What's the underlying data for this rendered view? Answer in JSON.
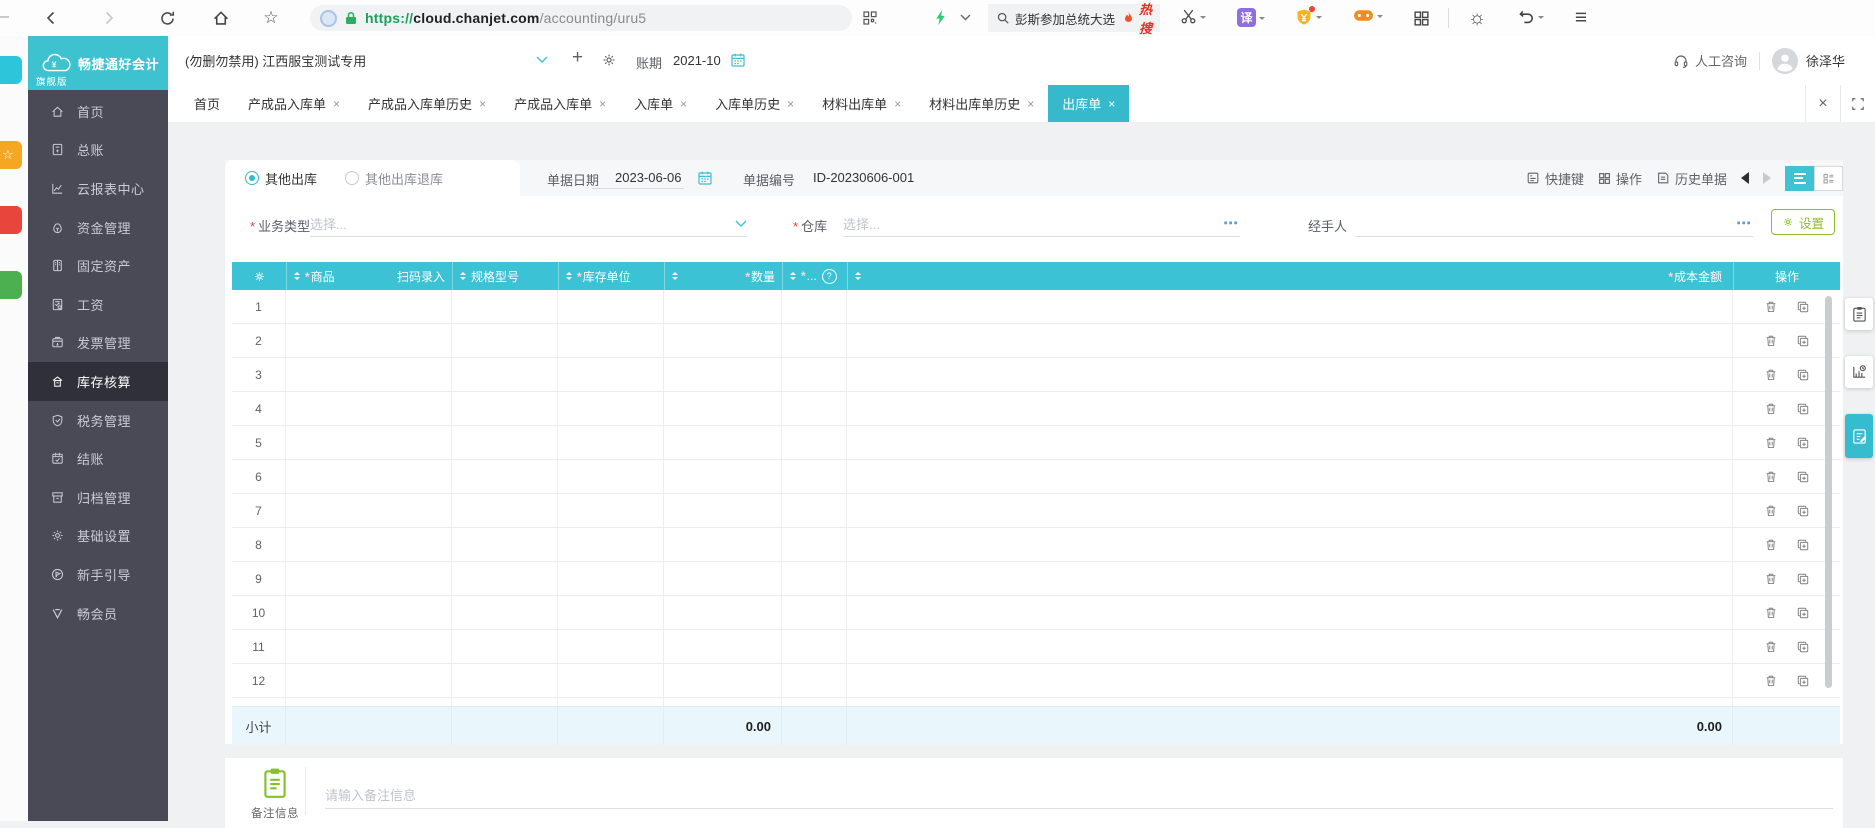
{
  "glyphs": {
    "close": "×",
    "plus": "+",
    "dots": "⋯",
    "help": "?",
    "star": "☆",
    "sun": "☼",
    "menu": "≡"
  },
  "browser": {
    "url_protocol": "https://",
    "url_domain": "cloud.chanjet.com",
    "url_path": "/accounting/uru5",
    "search_text": "彭斯参加总统大选",
    "hot_label": "热搜",
    "translate_glyph": "译"
  },
  "header": {
    "logo_title": "畅捷通好会计",
    "logo_badge": "旗舰版",
    "account_name": "(勿删勿禁用) 江西服宝测试专用",
    "period_label": "账期",
    "period_value": "2021-10",
    "support_label": "人工咨询",
    "user_name": "徐泽华"
  },
  "sidebar": {
    "items": [
      {
        "label": "首页"
      },
      {
        "label": "总账"
      },
      {
        "label": "云报表中心"
      },
      {
        "label": "资金管理"
      },
      {
        "label": "固定资产"
      },
      {
        "label": "工资"
      },
      {
        "label": "发票管理"
      },
      {
        "label": "库存核算"
      },
      {
        "label": "税务管理"
      },
      {
        "label": "结账"
      },
      {
        "label": "归档管理"
      },
      {
        "label": "基础设置"
      },
      {
        "label": "新手引导"
      },
      {
        "label": "畅会员"
      }
    ]
  },
  "tabs": {
    "items": [
      {
        "label": "首页"
      },
      {
        "label": "产成品入库单"
      },
      {
        "label": "产成品入库单历史"
      },
      {
        "label": "产成品入库单"
      },
      {
        "label": "入库单"
      },
      {
        "label": "入库单历史"
      },
      {
        "label": "材料出库单"
      },
      {
        "label": "材料出库单历史"
      },
      {
        "label": "出库单"
      }
    ]
  },
  "toolbar": {
    "radio_selected": "其他出库",
    "radio_unselected": "其他出库退库",
    "date_label": "单据日期",
    "date_value": "2023-06-06",
    "docno_label": "单据编号",
    "docno_value": "ID-20230606-001",
    "shortcuts_label": "快捷键",
    "actions_label": "操作",
    "history_label": "历史单据"
  },
  "form": {
    "biz_type_label": "业务类型",
    "biz_type_placeholder": "选择...",
    "warehouse_label": "仓库",
    "warehouse_placeholder": "选择...",
    "handler_label": "经手人",
    "settings_label": "设置"
  },
  "table": {
    "col_product": "商品",
    "col_scan": "扫码录入",
    "col_spec": "规格型号",
    "col_unit": "库存单位",
    "col_qty": "数量",
    "col_more": "...",
    "col_cost": "成本金额",
    "col_action": "操作",
    "row_numbers": [
      1,
      2,
      3,
      4,
      5,
      6,
      7,
      8,
      9,
      10,
      11,
      12
    ],
    "subtotal_label": "小计",
    "subtotal_qty": "0.00",
    "subtotal_cost": "0.00"
  },
  "remark": {
    "label": "备注信息",
    "placeholder": "请输入备注信息"
  }
}
